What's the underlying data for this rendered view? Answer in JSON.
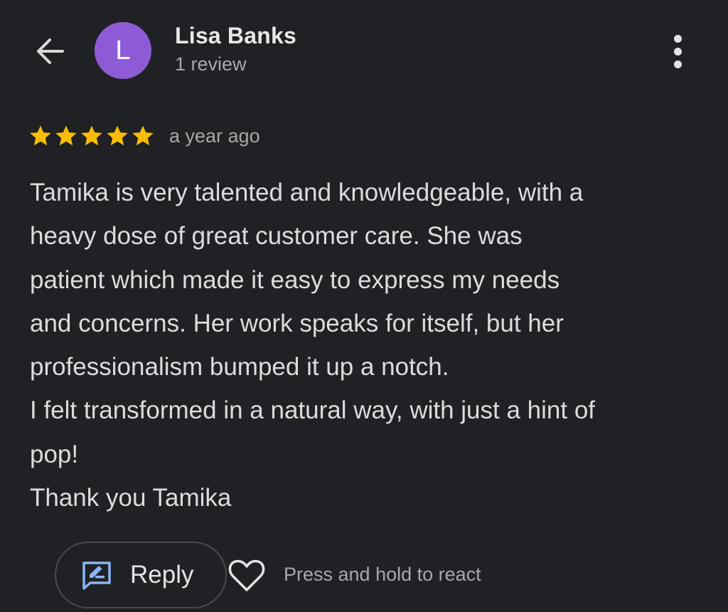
{
  "header": {
    "back_icon": "arrow-back-icon",
    "more_icon": "more-vert-icon"
  },
  "reviewer": {
    "avatar_initial": "L",
    "avatar_color": "#8e5bd6",
    "name": "Lisa Banks",
    "review_count": "1 review"
  },
  "review": {
    "rating": 5,
    "rating_max": 5,
    "star_color": "#fbbc04",
    "time_ago": "a year ago",
    "text_lines": [
      "Tamika is very talented and knowledgeable, with a",
      "heavy dose of great customer care. She was",
      "patient which made it easy to express my needs",
      "and concerns. Her work speaks for itself, but her",
      "professionalism bumped it up a notch.",
      "I felt transformed in a natural way, with just a hint of",
      "pop!",
      "Thank you Tamika"
    ]
  },
  "actions": {
    "reply_label": "Reply",
    "reply_icon": "reply-edit-icon",
    "reply_icon_color": "#8ab4f8",
    "react_icon": "heart-outline-icon",
    "react_hint": "Press and hold to react"
  }
}
